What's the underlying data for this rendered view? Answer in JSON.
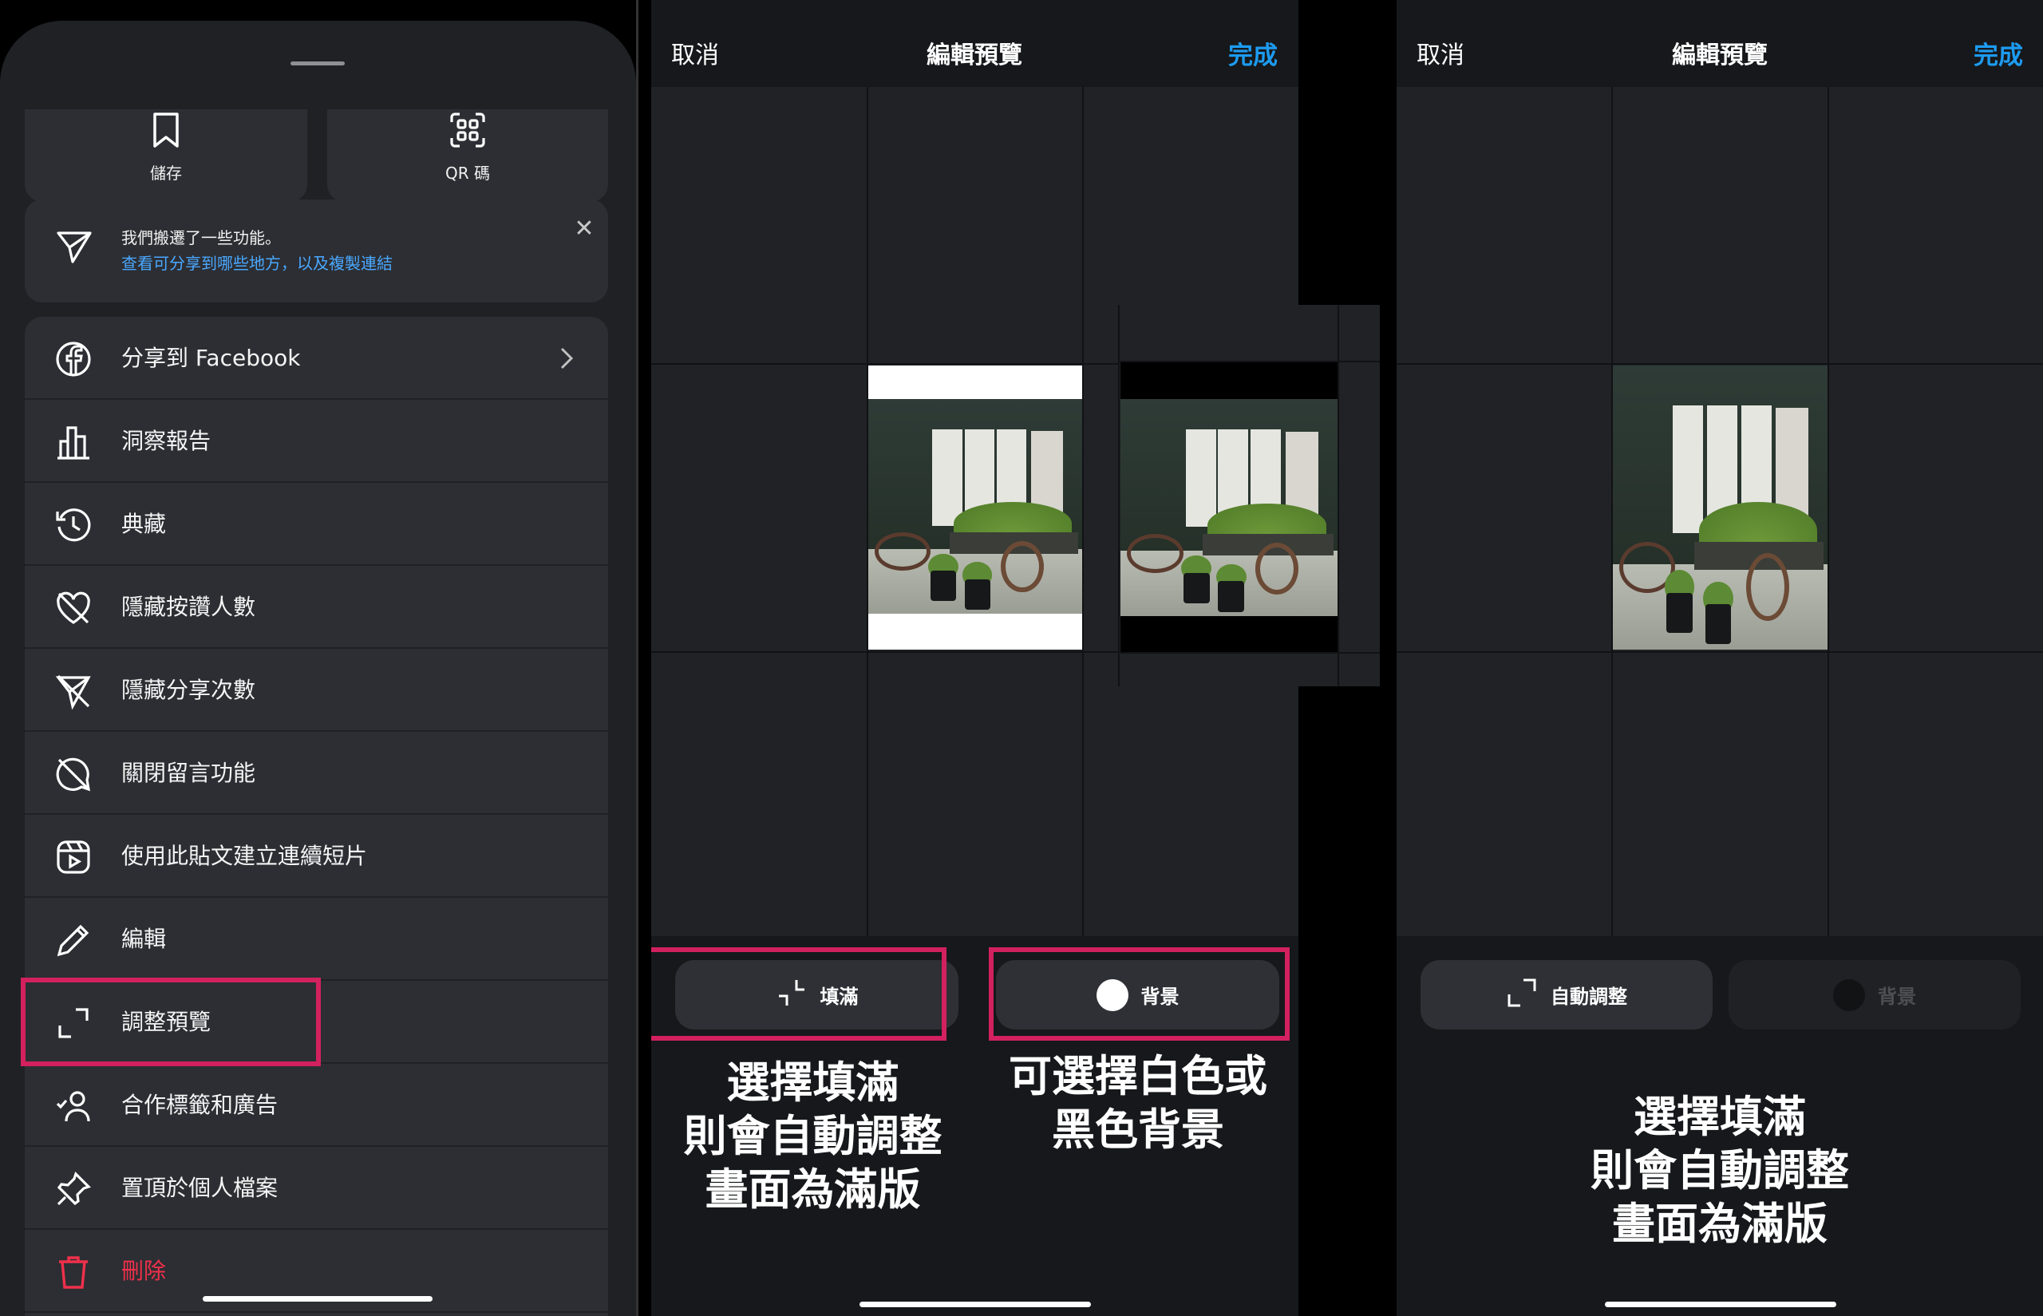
{
  "share_sheet": {
    "quick_actions": [
      {
        "label": "儲存",
        "icon": "bookmark-icon"
      },
      {
        "label": "QR 碼",
        "icon": "qr-code-icon"
      }
    ],
    "notice": {
      "line1": "我們搬遷了一些功能。",
      "line2": "查看可分享到哪些地方，以及複製連結",
      "icon": "send-icon",
      "close": "✕"
    },
    "menu": [
      {
        "label": "分享到 Facebook",
        "icon": "facebook-icon"
      },
      {
        "label": "洞察報告",
        "icon": "bar-chart-icon"
      },
      {
        "label": "典藏",
        "icon": "archive-history-icon"
      },
      {
        "label": "隱藏按讚人數",
        "icon": "hide-likes-icon"
      },
      {
        "label": "隱藏分享次數",
        "icon": "hide-shares-icon"
      },
      {
        "label": "關閉留言功能",
        "icon": "comments-off-icon"
      },
      {
        "label": "使用此貼文建立連續短片",
        "icon": "reels-icon"
      },
      {
        "label": "編輯",
        "icon": "pencil-icon"
      },
      {
        "label": "調整預覽",
        "icon": "expand-icon"
      },
      {
        "label": "合作標籤和廣告",
        "icon": "collab-icon"
      },
      {
        "label": "置頂於個人檔案",
        "icon": "pin-icon"
      },
      {
        "label": "刪除",
        "icon": "trash-icon"
      }
    ]
  },
  "editor_left": {
    "cancel": "取消",
    "title": "編輯預覽",
    "done": "完成",
    "fill_button": "填滿",
    "background_button": "背景",
    "caption_fill": [
      "選擇填滿",
      "則會自動調整",
      "畫面為滿版"
    ],
    "caption_background": [
      "可選擇白色或",
      "黑色背景"
    ]
  },
  "editor_right": {
    "cancel": "取消",
    "title": "編輯預覽",
    "done": "完成",
    "auto_button": "自動調整",
    "background_button": "背景",
    "caption": [
      "選擇填滿",
      "則會自動調整",
      "畫面為滿版"
    ]
  },
  "colors": {
    "accent_blue": "#1d9bf0",
    "link_blue": "#4aa8ff",
    "highlight": "#d2215e",
    "danger": "#f0304b"
  }
}
